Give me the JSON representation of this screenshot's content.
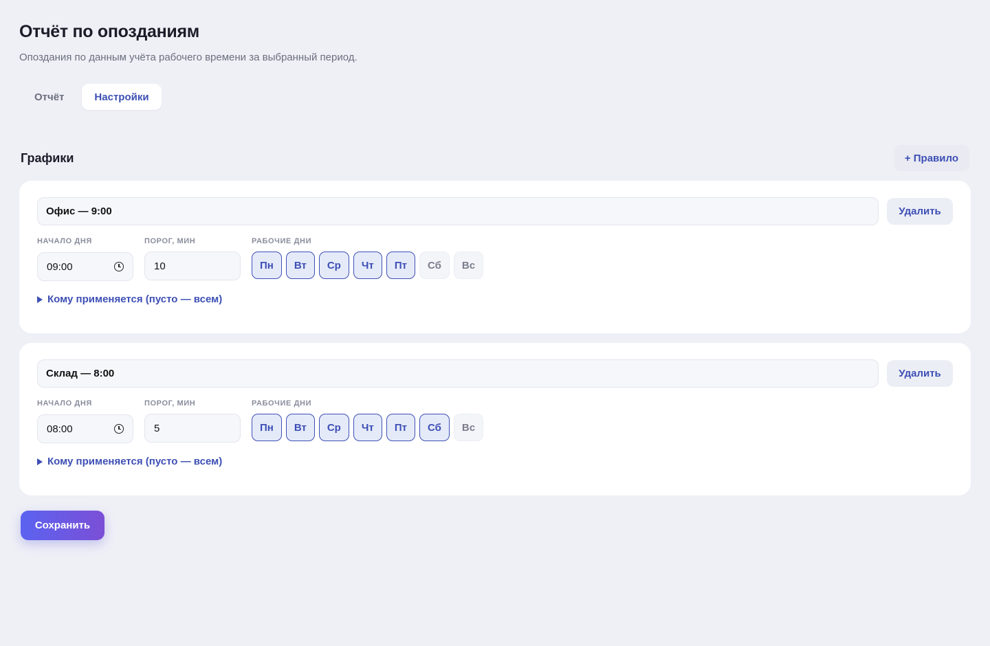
{
  "header": {
    "title": "Отчёт по опозданиям",
    "subtitle": "Опоздания по данным учёта рабочего времени за выбранный период."
  },
  "tabs": [
    {
      "label": "Отчёт",
      "active": false
    },
    {
      "label": "Настройки",
      "active": true
    }
  ],
  "section": {
    "title": "Графики",
    "add_rule_label": "+ Правило"
  },
  "labels": {
    "start": "НАЧАЛО ДНЯ",
    "threshold": "ПОРОГ, МИН",
    "workdays": "РАБОЧИЕ ДНИ",
    "delete": "Удалить",
    "applies": "Кому применяется (пусто — всем)"
  },
  "schedules": [
    {
      "name": "Офис — 9:00",
      "start": "09:00",
      "threshold": "10",
      "days": [
        {
          "label": "Пн",
          "on": true
        },
        {
          "label": "Вт",
          "on": true
        },
        {
          "label": "Ср",
          "on": true
        },
        {
          "label": "Чт",
          "on": true
        },
        {
          "label": "Пт",
          "on": true
        },
        {
          "label": "Сб",
          "on": false
        },
        {
          "label": "Вс",
          "on": false
        }
      ]
    },
    {
      "name": "Склад — 8:00",
      "start": "08:00",
      "threshold": "5",
      "days": [
        {
          "label": "Пн",
          "on": true
        },
        {
          "label": "Вт",
          "on": true
        },
        {
          "label": "Ср",
          "on": true
        },
        {
          "label": "Чт",
          "on": true
        },
        {
          "label": "Пт",
          "on": true
        },
        {
          "label": "Сб",
          "on": true
        },
        {
          "label": "Вс",
          "on": false
        }
      ]
    }
  ],
  "actions": {
    "save_label": "Сохранить"
  },
  "colors": {
    "accent": "#3d4fb5",
    "background": "#eff0f6",
    "save_gradient_start": "#5b63f0",
    "save_gradient_end": "#7b4fd6"
  },
  "icons": {
    "time": "clock-icon",
    "expand": "triangle-right-icon"
  }
}
